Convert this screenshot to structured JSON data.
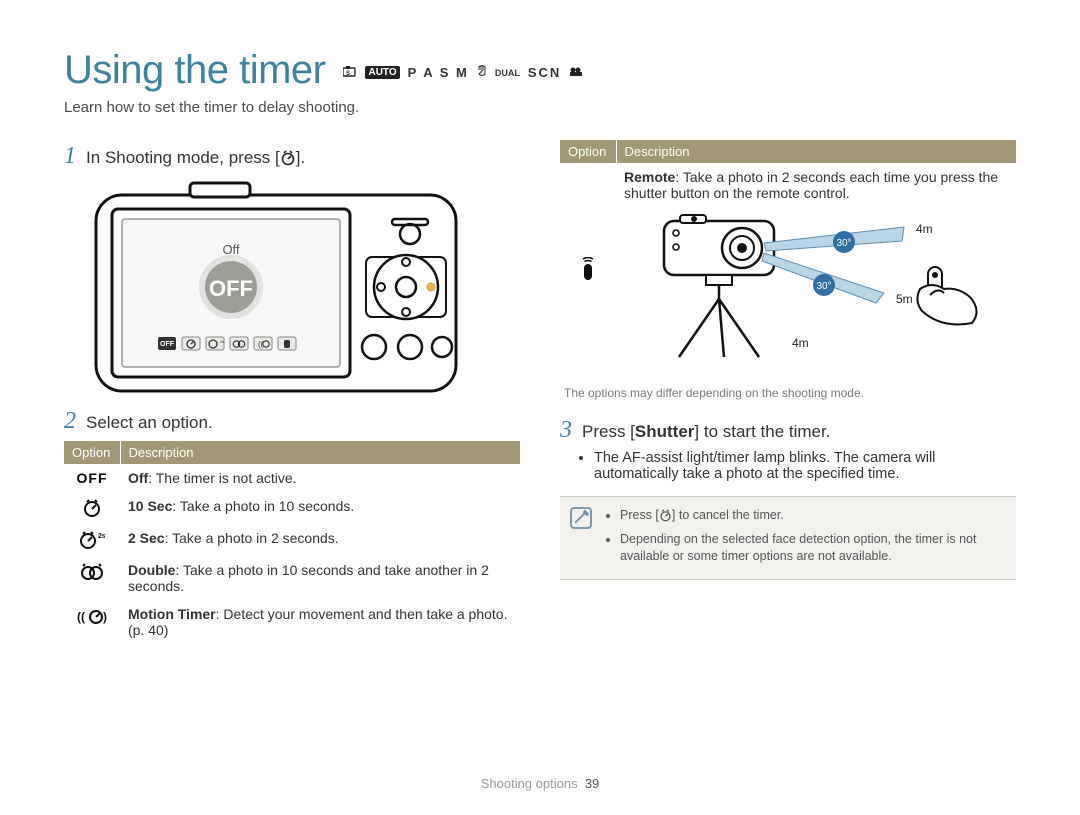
{
  "title": "Using the timer",
  "modes": {
    "auto": "AUTO",
    "letters": "P A S M",
    "dual": "DUAL",
    "scn": "SCN"
  },
  "subtitle": "Learn how to set the timer to delay shooting.",
  "step1": {
    "num": "1",
    "text_pre": "In Shooting mode, press [",
    "text_post": "]."
  },
  "camera_screen": {
    "label": "Off",
    "badge": "OFF"
  },
  "step2": {
    "num": "2",
    "text": "Select an option."
  },
  "options_header": {
    "opt": "Option",
    "desc": "Description"
  },
  "options_left": [
    {
      "icon": "off",
      "label": "Off",
      "desc": ": The timer is not active."
    },
    {
      "icon": "t10",
      "label": "10 Sec",
      "desc": ": Take a photo in 10 seconds."
    },
    {
      "icon": "t2",
      "label": "2 Sec",
      "desc": ": Take a photo in 2 seconds."
    },
    {
      "icon": "double",
      "label": "Double",
      "desc": ": Take a photo in 10 seconds and take another in 2 seconds."
    },
    {
      "icon": "motion",
      "label": "Motion Timer",
      "desc": ": Detect your movement and then take a photo. (p. 40)"
    }
  ],
  "remote": {
    "label": "Remote",
    "desc": ": Take a photo in 2 seconds each time you press the shutter button on the remote control.",
    "angle": "30°",
    "dist_4m": "4m",
    "dist_5m": "5m",
    "footnote": "The options may differ depending on the shooting mode."
  },
  "step3": {
    "num": "3",
    "text_pre": "Press [",
    "shutter": "Shutter",
    "text_post": "] to start the timer.",
    "bullet": "The AF-assist light/timer lamp blinks. The camera will automatically take a photo at the specified time."
  },
  "note": {
    "li1_pre": "Press [",
    "li1_post": "] to cancel the timer.",
    "li2": "Depending on the selected face detection option, the timer is not available or some timer options are not available."
  },
  "footer": {
    "section": "Shooting options",
    "page": "39"
  }
}
